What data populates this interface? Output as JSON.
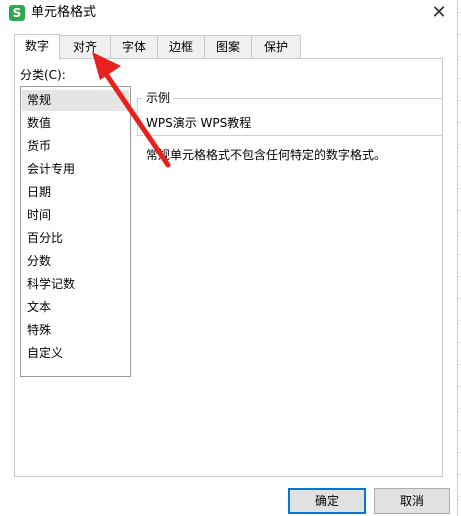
{
  "window": {
    "app_icon_letter": "S",
    "title": "单元格格式"
  },
  "tabs": [
    {
      "label": "数字",
      "active": true
    },
    {
      "label": "对齐",
      "active": false
    },
    {
      "label": "字体",
      "active": false
    },
    {
      "label": "边框",
      "active": false
    },
    {
      "label": "图案",
      "active": false
    },
    {
      "label": "保护",
      "active": false
    }
  ],
  "number_tab": {
    "category_label": "分类(C):",
    "categories": [
      "常规",
      "数值",
      "货币",
      "会计专用",
      "日期",
      "时间",
      "百分比",
      "分数",
      "科学记数",
      "文本",
      "特殊",
      "自定义"
    ],
    "selected_category": "常规",
    "sample_legend": "示例",
    "sample_value": "WPS演示 WPS教程",
    "description": "常规单元格格式不包含任何特定的数字格式。"
  },
  "buttons": {
    "ok": "确定",
    "cancel": "取消"
  },
  "annotation": {
    "arrow_color": "#e8201e"
  }
}
